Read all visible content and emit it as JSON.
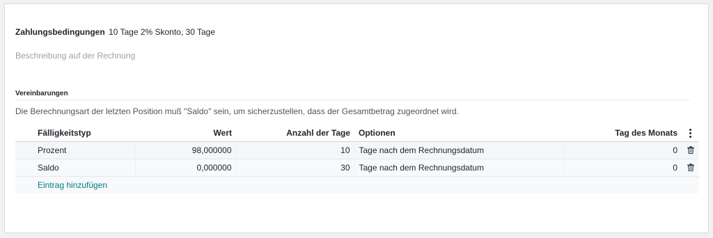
{
  "payment_terms": {
    "label": "Zahlungsbedingungen",
    "value": "10 Tage 2% Skonto, 30 Tage"
  },
  "description": {
    "placeholder": "Beschreibung auf der Rechnung"
  },
  "agreements": {
    "title": "Vereinbarungen",
    "info": "Die Berechnungsart der letzten Position muß \"Saldo\" sein, um sicherzustellen, dass der Gesamtbetrag zugeordnet wird."
  },
  "table": {
    "headers": {
      "due_type": "Fälligkeitstyp",
      "value": "Wert",
      "days": "Anzahl der Tage",
      "options": "Optionen",
      "day_of_month": "Tag des Monats"
    },
    "rows": [
      {
        "due_type": "Prozent",
        "value": "98,000000",
        "days": "10",
        "options": "Tage nach dem Rechnungsdatum",
        "day_of_month": "0"
      },
      {
        "due_type": "Saldo",
        "value": "0,000000",
        "days": "30",
        "options": "Tage nach dem Rechnungsdatum",
        "day_of_month": "0"
      }
    ],
    "add_line": "Eintrag hinzufügen"
  },
  "icons": {
    "column_menu": "kebab-vertical-icon",
    "delete": "trash-icon"
  },
  "colors": {
    "link": "#017e84",
    "muted": "#9aa0a6"
  }
}
